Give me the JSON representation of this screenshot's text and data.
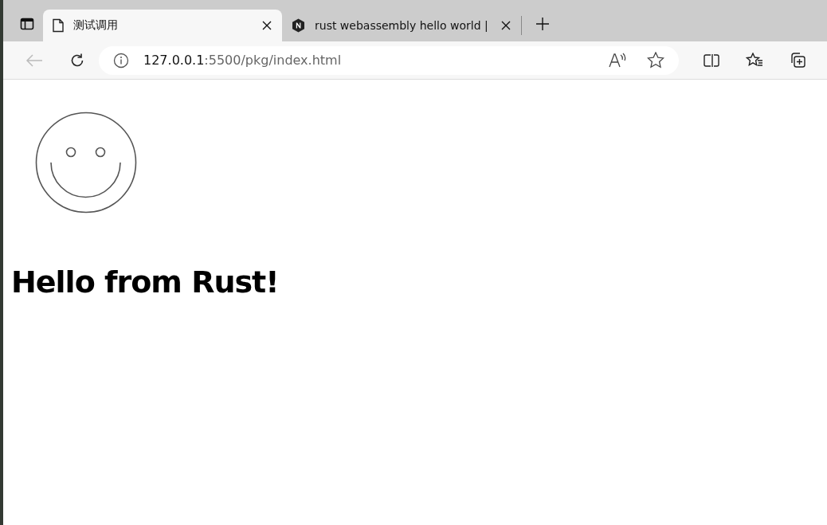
{
  "tabs": [
    {
      "title": "测试调用",
      "selected": true,
      "kind": "document"
    },
    {
      "title": "rust webassembly hello world |",
      "selected": false,
      "kind": "site"
    }
  ],
  "address_bar": {
    "host": "127.0.0.1",
    "path": ":5500/pkg/index.html"
  },
  "page": {
    "heading": "Hello from Rust!"
  }
}
